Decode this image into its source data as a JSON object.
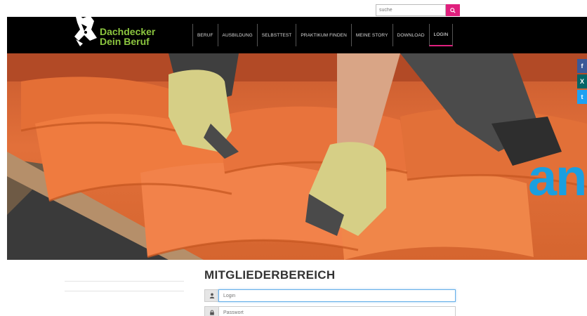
{
  "search": {
    "placeholder": "suche",
    "button_icon": "search-icon"
  },
  "logo": {
    "line1": "Dachdecker",
    "line2": "Dein Beruf"
  },
  "nav": {
    "items": [
      {
        "label": "BERUF"
      },
      {
        "label": "AUSBILDUNG"
      },
      {
        "label": "SELBSTTEST"
      },
      {
        "label": "PRAKTIKUM FINDEN"
      },
      {
        "label": "MEINE STORY"
      },
      {
        "label": "DOWNLOAD"
      },
      {
        "label": "LOGIN",
        "active": true
      }
    ]
  },
  "social": [
    {
      "name": "facebook-icon",
      "glyph": "f",
      "color": "#3b5998"
    },
    {
      "name": "xing-icon",
      "glyph": "X",
      "color": "#026466"
    },
    {
      "name": "twitter-icon",
      "glyph": "t",
      "color": "#1da1f2"
    }
  ],
  "hero": {
    "overlay_text": "an"
  },
  "members": {
    "title": "MITGLIEDERBEREICH",
    "login_placeholder": "Login",
    "password_placeholder": "Passwort"
  },
  "colors": {
    "accent": "#e0207e",
    "brand_green": "#8cc63f",
    "header_bg": "#000000",
    "overlay_blue": "#1a9fe0"
  }
}
